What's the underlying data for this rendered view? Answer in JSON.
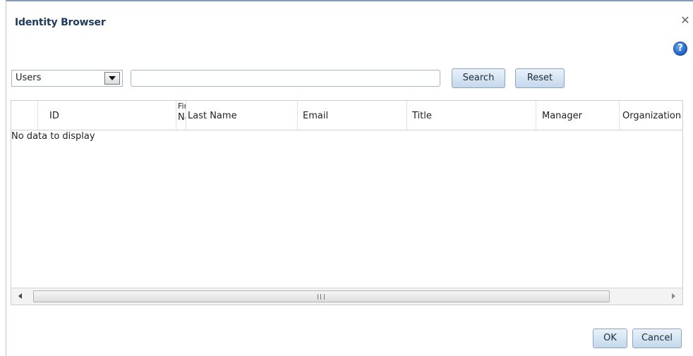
{
  "dialog": {
    "title": "Identity Browser",
    "close_icon": "close-icon",
    "help_label": "?"
  },
  "filter": {
    "type_selected": "Users",
    "search_value": "",
    "search_label": "Search",
    "reset_label": "Reset"
  },
  "table": {
    "columns": {
      "id": "ID",
      "first_name_l1": "Firs",
      "first_name_l2": "Na",
      "last_name": "Last Name",
      "email": "Email",
      "title": "Title",
      "manager": "Manager",
      "organization": "Organization"
    },
    "empty_message": "No data to display"
  },
  "footer": {
    "ok_label": "OK",
    "cancel_label": "Cancel"
  }
}
